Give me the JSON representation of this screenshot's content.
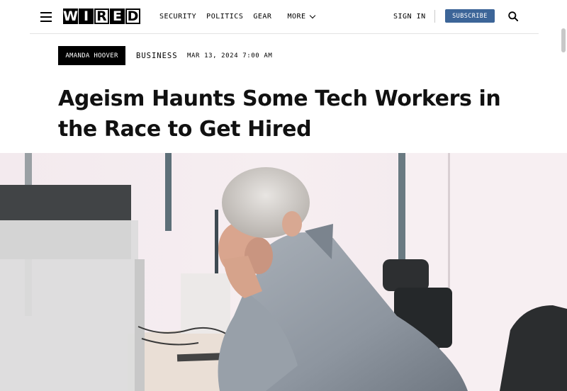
{
  "header": {
    "menu_icon": "hamburger-menu-icon",
    "logo_letters": [
      "W",
      "I",
      "R",
      "E",
      "D"
    ],
    "nav_links": [
      "SECURITY",
      "POLITICS",
      "GEAR"
    ],
    "more_label": "MORE",
    "sign_in_label": "SIGN IN",
    "subscribe_label": "SUBSCRIBE",
    "search_icon": "search-icon",
    "accent_color": "#3c6598"
  },
  "article": {
    "author": "AMANDA HOOVER",
    "category": "BUSINESS",
    "date": "MAR 13, 2024 7:00 AM",
    "headline": "Ageism Haunts Some Tech Workers in the Race to Get Hired"
  }
}
